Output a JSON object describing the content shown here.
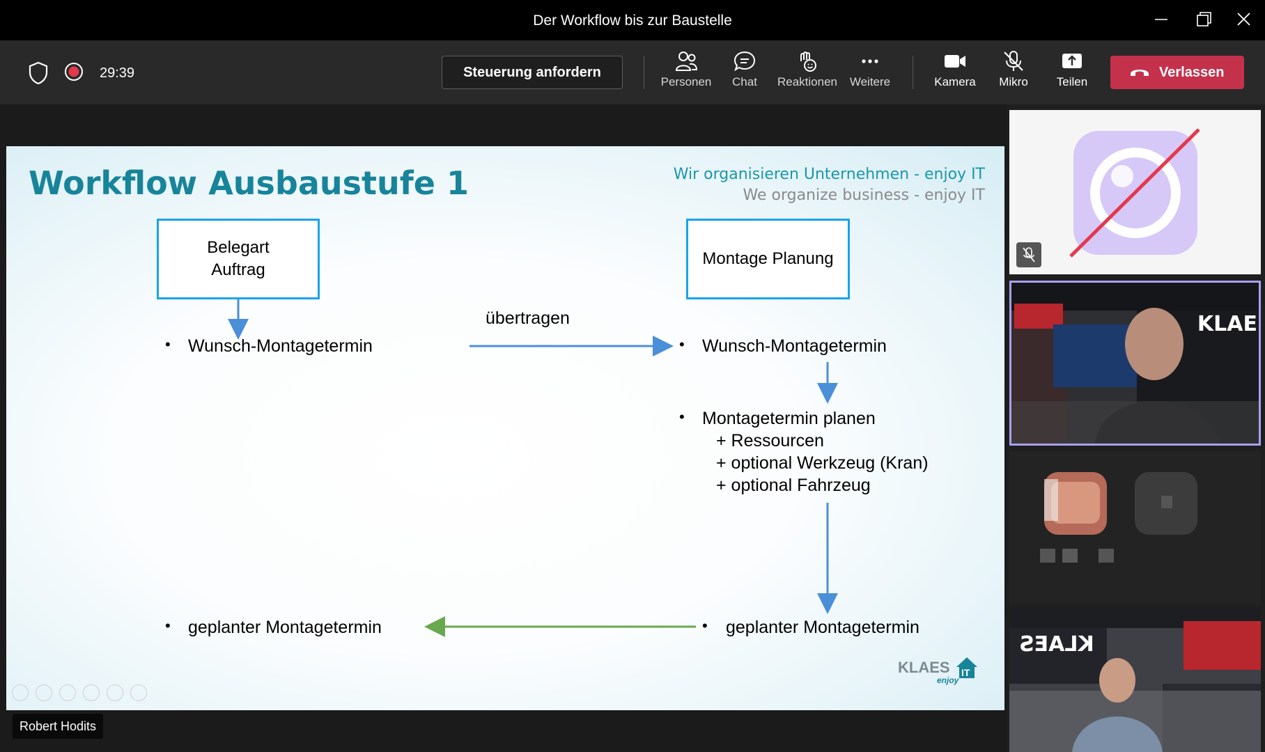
{
  "window": {
    "title": "Der Workflow bis zur Baustelle"
  },
  "toolbar": {
    "timer": "29:39",
    "request_control_label": "Steuerung anfordern",
    "people_label": "Personen",
    "chat_label": "Chat",
    "reactions_label": "Reaktionen",
    "more_label": "Weitere",
    "camera_label": "Kamera",
    "mic_label": "Mikro",
    "share_label": "Teilen",
    "leave_label": "Verlassen",
    "leave_color": "#c4314b"
  },
  "slide": {
    "title": "Workflow Ausbaustufe 1",
    "tagline_de": "Wir organisieren Unternehmen - enjoy IT",
    "tagline_en": "We organize business - enjoy IT",
    "box_left_line1": "Belegart",
    "box_left_line2": "Auftrag",
    "box_right": "Montage Planung",
    "arrow_label": "übertragen",
    "left_item1": "Wunsch-Montagetermin",
    "right_item1": "Wunsch-Montagetermin",
    "right_item2": "Montagetermin planen",
    "right_sub1": "+ Ressourcen",
    "right_sub2": "+ optional Werkzeug (Kran)",
    "right_sub3": "+ optional Fahrzeug",
    "right_item3": "geplanter Montagetermin",
    "left_item2": "geplanter Montagetermin",
    "bullet": "•",
    "logo_text": "KLAES",
    "logo_sub": "enjoy",
    "logo_it": "IT",
    "accent_color": "#17849a",
    "box_border_color": "#19a4e6",
    "arrow_blue": "#4a8fd8",
    "arrow_green": "#6aa84f"
  },
  "presenter": {
    "name": "Robert Hodits"
  },
  "participants": {
    "tile2_banner": "KLAE",
    "tile4_banner": "KLAES"
  }
}
